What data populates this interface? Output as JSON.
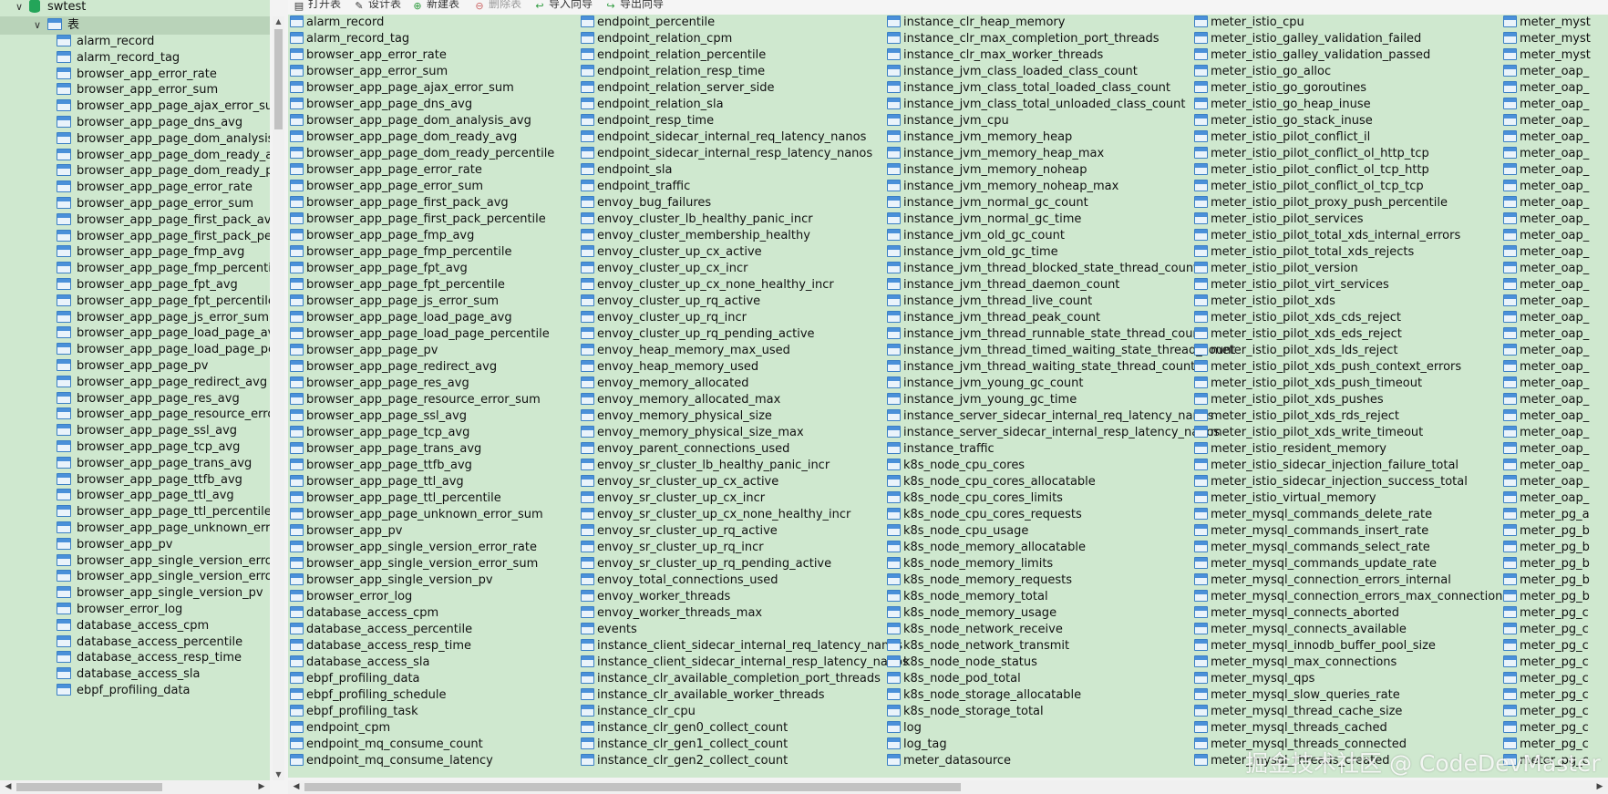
{
  "tree": {
    "database": "swtest",
    "folder": "表",
    "tables": [
      "alarm_record",
      "alarm_record_tag",
      "browser_app_error_rate",
      "browser_app_error_sum",
      "browser_app_page_ajax_error_sum",
      "browser_app_page_dns_avg",
      "browser_app_page_dom_analysis_av",
      "browser_app_page_dom_ready_avg",
      "browser_app_page_dom_ready_perc",
      "browser_app_page_error_rate",
      "browser_app_page_error_sum",
      "browser_app_page_first_pack_avg",
      "browser_app_page_first_pack_perce",
      "browser_app_page_fmp_avg",
      "browser_app_page_fmp_percentile",
      "browser_app_page_fpt_avg",
      "browser_app_page_fpt_percentile",
      "browser_app_page_js_error_sum",
      "browser_app_page_load_page_avg",
      "browser_app_page_load_page_perc",
      "browser_app_page_pv",
      "browser_app_page_redirect_avg",
      "browser_app_page_res_avg",
      "browser_app_page_resource_error_s",
      "browser_app_page_ssl_avg",
      "browser_app_page_tcp_avg",
      "browser_app_page_trans_avg",
      "browser_app_page_ttfb_avg",
      "browser_app_page_ttl_avg",
      "browser_app_page_ttl_percentile",
      "browser_app_page_unknown_error_",
      "browser_app_pv",
      "browser_app_single_version_error_ra",
      "browser_app_single_version_error_s",
      "browser_app_single_version_pv",
      "browser_error_log",
      "database_access_cpm",
      "database_access_percentile",
      "database_access_resp_time",
      "database_access_sla",
      "ebpf_profiling_data"
    ]
  },
  "toolbar": {
    "open": "打开表",
    "design": "设计表",
    "new": "新建表",
    "delete": "删除表",
    "import": "导入向导",
    "export": "导出向导"
  },
  "columns": [
    [
      "alarm_record",
      "alarm_record_tag",
      "browser_app_error_rate",
      "browser_app_error_sum",
      "browser_app_page_ajax_error_sum",
      "browser_app_page_dns_avg",
      "browser_app_page_dom_analysis_avg",
      "browser_app_page_dom_ready_avg",
      "browser_app_page_dom_ready_percentile",
      "browser_app_page_error_rate",
      "browser_app_page_error_sum",
      "browser_app_page_first_pack_avg",
      "browser_app_page_first_pack_percentile",
      "browser_app_page_fmp_avg",
      "browser_app_page_fmp_percentile",
      "browser_app_page_fpt_avg",
      "browser_app_page_fpt_percentile",
      "browser_app_page_js_error_sum",
      "browser_app_page_load_page_avg",
      "browser_app_page_load_page_percentile",
      "browser_app_page_pv",
      "browser_app_page_redirect_avg",
      "browser_app_page_res_avg",
      "browser_app_page_resource_error_sum",
      "browser_app_page_ssl_avg",
      "browser_app_page_tcp_avg",
      "browser_app_page_trans_avg",
      "browser_app_page_ttfb_avg",
      "browser_app_page_ttl_avg",
      "browser_app_page_ttl_percentile",
      "browser_app_page_unknown_error_sum",
      "browser_app_pv",
      "browser_app_single_version_error_rate",
      "browser_app_single_version_error_sum",
      "browser_app_single_version_pv",
      "browser_error_log",
      "database_access_cpm",
      "database_access_percentile",
      "database_access_resp_time",
      "database_access_sla",
      "ebpf_profiling_data",
      "ebpf_profiling_schedule",
      "ebpf_profiling_task",
      "endpoint_cpm",
      "endpoint_mq_consume_count",
      "endpoint_mq_consume_latency"
    ],
    [
      "endpoint_percentile",
      "endpoint_relation_cpm",
      "endpoint_relation_percentile",
      "endpoint_relation_resp_time",
      "endpoint_relation_server_side",
      "endpoint_relation_sla",
      "endpoint_resp_time",
      "endpoint_sidecar_internal_req_latency_nanos",
      "endpoint_sidecar_internal_resp_latency_nanos",
      "endpoint_sla",
      "endpoint_traffic",
      "envoy_bug_failures",
      "envoy_cluster_lb_healthy_panic_incr",
      "envoy_cluster_membership_healthy",
      "envoy_cluster_up_cx_active",
      "envoy_cluster_up_cx_incr",
      "envoy_cluster_up_cx_none_healthy_incr",
      "envoy_cluster_up_rq_active",
      "envoy_cluster_up_rq_incr",
      "envoy_cluster_up_rq_pending_active",
      "envoy_heap_memory_max_used",
      "envoy_heap_memory_used",
      "envoy_memory_allocated",
      "envoy_memory_allocated_max",
      "envoy_memory_physical_size",
      "envoy_memory_physical_size_max",
      "envoy_parent_connections_used",
      "envoy_sr_cluster_lb_healthy_panic_incr",
      "envoy_sr_cluster_up_cx_active",
      "envoy_sr_cluster_up_cx_incr",
      "envoy_sr_cluster_up_cx_none_healthy_incr",
      "envoy_sr_cluster_up_rq_active",
      "envoy_sr_cluster_up_rq_incr",
      "envoy_sr_cluster_up_rq_pending_active",
      "envoy_total_connections_used",
      "envoy_worker_threads",
      "envoy_worker_threads_max",
      "events",
      "instance_client_sidecar_internal_req_latency_nanos",
      "instance_client_sidecar_internal_resp_latency_nanos",
      "instance_clr_available_completion_port_threads",
      "instance_clr_available_worker_threads",
      "instance_clr_cpu",
      "instance_clr_gen0_collect_count",
      "instance_clr_gen1_collect_count",
      "instance_clr_gen2_collect_count"
    ],
    [
      "instance_clr_heap_memory",
      "instance_clr_max_completion_port_threads",
      "instance_clr_max_worker_threads",
      "instance_jvm_class_loaded_class_count",
      "instance_jvm_class_total_loaded_class_count",
      "instance_jvm_class_total_unloaded_class_count",
      "instance_jvm_cpu",
      "instance_jvm_memory_heap",
      "instance_jvm_memory_heap_max",
      "instance_jvm_memory_noheap",
      "instance_jvm_memory_noheap_max",
      "instance_jvm_normal_gc_count",
      "instance_jvm_normal_gc_time",
      "instance_jvm_old_gc_count",
      "instance_jvm_old_gc_time",
      "instance_jvm_thread_blocked_state_thread_count",
      "instance_jvm_thread_daemon_count",
      "instance_jvm_thread_live_count",
      "instance_jvm_thread_peak_count",
      "instance_jvm_thread_runnable_state_thread_count",
      "instance_jvm_thread_timed_waiting_state_thread_count",
      "instance_jvm_thread_waiting_state_thread_count",
      "instance_jvm_young_gc_count",
      "instance_jvm_young_gc_time",
      "instance_server_sidecar_internal_req_latency_nanos",
      "instance_server_sidecar_internal_resp_latency_nanos",
      "instance_traffic",
      "k8s_node_cpu_cores",
      "k8s_node_cpu_cores_allocatable",
      "k8s_node_cpu_cores_limits",
      "k8s_node_cpu_cores_requests",
      "k8s_node_cpu_usage",
      "k8s_node_memory_allocatable",
      "k8s_node_memory_limits",
      "k8s_node_memory_requests",
      "k8s_node_memory_total",
      "k8s_node_memory_usage",
      "k8s_node_network_receive",
      "k8s_node_network_transmit",
      "k8s_node_node_status",
      "k8s_node_pod_total",
      "k8s_node_storage_allocatable",
      "k8s_node_storage_total",
      "log",
      "log_tag",
      "meter_datasource"
    ],
    [
      "meter_istio_cpu",
      "meter_istio_galley_validation_failed",
      "meter_istio_galley_validation_passed",
      "meter_istio_go_alloc",
      "meter_istio_go_goroutines",
      "meter_istio_go_heap_inuse",
      "meter_istio_go_stack_inuse",
      "meter_istio_pilot_conflict_il",
      "meter_istio_pilot_conflict_ol_http_tcp",
      "meter_istio_pilot_conflict_ol_tcp_http",
      "meter_istio_pilot_conflict_ol_tcp_tcp",
      "meter_istio_pilot_proxy_push_percentile",
      "meter_istio_pilot_services",
      "meter_istio_pilot_total_xds_internal_errors",
      "meter_istio_pilot_total_xds_rejects",
      "meter_istio_pilot_version",
      "meter_istio_pilot_virt_services",
      "meter_istio_pilot_xds",
      "meter_istio_pilot_xds_cds_reject",
      "meter_istio_pilot_xds_eds_reject",
      "meter_istio_pilot_xds_lds_reject",
      "meter_istio_pilot_xds_push_context_errors",
      "meter_istio_pilot_xds_push_timeout",
      "meter_istio_pilot_xds_pushes",
      "meter_istio_pilot_xds_rds_reject",
      "meter_istio_pilot_xds_write_timeout",
      "meter_istio_resident_memory",
      "meter_istio_sidecar_injection_failure_total",
      "meter_istio_sidecar_injection_success_total",
      "meter_istio_virtual_memory",
      "meter_mysql_commands_delete_rate",
      "meter_mysql_commands_insert_rate",
      "meter_mysql_commands_select_rate",
      "meter_mysql_commands_update_rate",
      "meter_mysql_connection_errors_internal",
      "meter_mysql_connection_errors_max_connections",
      "meter_mysql_connects_aborted",
      "meter_mysql_connects_available",
      "meter_mysql_innodb_buffer_pool_size",
      "meter_mysql_max_connections",
      "meter_mysql_qps",
      "meter_mysql_slow_queries_rate",
      "meter_mysql_thread_cache_size",
      "meter_mysql_threads_cached",
      "meter_mysql_threads_connected",
      "meter_mysql_threads_created"
    ],
    [
      "meter_myst",
      "meter_myst",
      "meter_myst",
      "meter_oap_",
      "meter_oap_",
      "meter_oap_",
      "meter_oap_",
      "meter_oap_",
      "meter_oap_",
      "meter_oap_",
      "meter_oap_",
      "meter_oap_",
      "meter_oap_",
      "meter_oap_",
      "meter_oap_",
      "meter_oap_",
      "meter_oap_",
      "meter_oap_",
      "meter_oap_",
      "meter_oap_",
      "meter_oap_",
      "meter_oap_",
      "meter_oap_",
      "meter_oap_",
      "meter_oap_",
      "meter_oap_",
      "meter_oap_",
      "meter_oap_",
      "meter_oap_",
      "meter_oap_",
      "meter_pg_a",
      "meter_pg_b",
      "meter_pg_b",
      "meter_pg_b",
      "meter_pg_b",
      "meter_pg_b",
      "meter_pg_c",
      "meter_pg_c",
      "meter_pg_c",
      "meter_pg_c",
      "meter_pg_c",
      "meter_pg_c",
      "meter_pg_c",
      "meter_pg_c",
      "meter_pg_c",
      "meter_pg_c"
    ]
  ],
  "watermark": "掘金技术社区 @ CodeDevMaster"
}
